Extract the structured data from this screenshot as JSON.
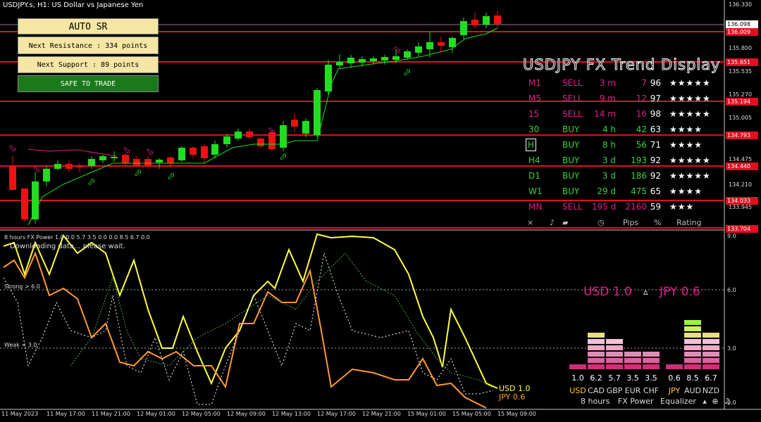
{
  "window": {
    "title": "USDJPY.s, H1:  US Dollar vs Japanese Yen"
  },
  "auto_sr": {
    "title": "AUTO SR",
    "next_resistance": "Next Resistance : 334 points",
    "next_support": "Next Support : 89 points",
    "status": "SAFE TO TRADE"
  },
  "trend_display": {
    "title": "USDJPY FX Trend Display",
    "rows": [
      {
        "tf": "M1",
        "signal": "SELL",
        "time": "3 m",
        "pips": "7",
        "pct": "96",
        "stars": "★★★★★"
      },
      {
        "tf": "M5",
        "signal": "SELL",
        "time": "9 m",
        "pips": "12",
        "pct": "97",
        "stars": "★★★★★"
      },
      {
        "tf": "15",
        "signal": "SELL",
        "time": "14 m",
        "pips": "16",
        "pct": "98",
        "stars": "★★★★★"
      },
      {
        "tf": "30",
        "signal": "BUY",
        "time": "4 h",
        "pips": "42",
        "pct": "63",
        "stars": "★★★★"
      },
      {
        "tf": "H",
        "signal": "BUY",
        "time": "8 h",
        "pips": "56",
        "pct": "71",
        "stars": "★★★★"
      },
      {
        "tf": "H4",
        "signal": "BUY",
        "time": "3 d",
        "pips": "193",
        "pct": "92",
        "stars": "★★★★★"
      },
      {
        "tf": "D1",
        "signal": "BUY",
        "time": "3 d",
        "pips": "186",
        "pct": "92",
        "stars": "★★★★★"
      },
      {
        "tf": "W1",
        "signal": "BUY",
        "time": "29 d",
        "pips": "475",
        "pct": "65",
        "stars": "★★★★"
      },
      {
        "tf": "MN",
        "signal": "SELL",
        "time": "195 d",
        "pips": "2160",
        "pct": "59",
        "stars": "★★★"
      }
    ],
    "footer": {
      "close": "×",
      "sound": "♪",
      "pips": "Pips",
      "pct": "%",
      "rating": "Rating"
    }
  },
  "price_axis": [
    "136.330",
    "135.800",
    "135.535",
    "135.270",
    "135.005",
    "134.475",
    "134.210",
    "133.945"
  ],
  "price_tags": [
    {
      "label": "136.098",
      "kind": "bid"
    },
    {
      "label": "136.009",
      "kind": "sr"
    },
    {
      "label": "135.651",
      "kind": "sr"
    },
    {
      "label": "135.194",
      "kind": "sr"
    },
    {
      "label": "134.793",
      "kind": "sr"
    },
    {
      "label": "134.440",
      "kind": "sr"
    },
    {
      "label": "134.033",
      "kind": "sr"
    },
    {
      "label": "133.704",
      "kind": "sr"
    }
  ],
  "time_axis": [
    "11 May 2023",
    "11 May 17:00",
    "11 May 21:00",
    "12 May 01:00",
    "12 May 05:00",
    "12 May 09:00",
    "12 May 13:00",
    "12 May 17:00",
    "12 May 21:00",
    "15 May 01:00",
    "15 May 05:00",
    "15 May 09:00"
  ],
  "indicator": {
    "header": "8 hours FX Power 1.0 0.0 5.7 3.5 0.0 0.0 8.5 6.7 0.0",
    "loading": "Downloading data... please wait.",
    "strong": "Strong > 6.0",
    "weak": "Weak < 3.0",
    "axis": [
      "9.0",
      "6.0",
      "3.0",
      "0.0"
    ],
    "usd_label": "USD 1.0",
    "jpy_label": "JPY 0.6"
  },
  "power": {
    "usd_big": "USD 1.0",
    "delta": "▵",
    "jpy_big": "JPY 0.6",
    "currencies": [
      {
        "code": "USD",
        "value": "1.0",
        "level": 1,
        "hl": true
      },
      {
        "code": "CAD",
        "value": "6.2",
        "level": 6
      },
      {
        "code": "GBP",
        "value": "5.7",
        "level": 5
      },
      {
        "code": "EUR",
        "value": "3.5",
        "level": 3
      },
      {
        "code": "CHF",
        "value": "3.5",
        "level": 3
      },
      {
        "code": "JPY",
        "value": "0.6",
        "level": 1,
        "hl": true
      },
      {
        "code": "AUD",
        "value": "8.5",
        "level": 8
      },
      {
        "code": "NZD",
        "value": "6.7",
        "level": 6
      }
    ],
    "footer_period": "8 hours",
    "footer_name": "FX Power",
    "footer_eq": "Equalizer"
  },
  "colors": {
    "sr_line": "#e01020",
    "bull": "#22dd22",
    "bear": "#ee1111",
    "usd_line": "#ffff44",
    "jpy_line": "#ff9930",
    "sell": "#e0208f",
    "buy": "#3cd13c"
  }
}
